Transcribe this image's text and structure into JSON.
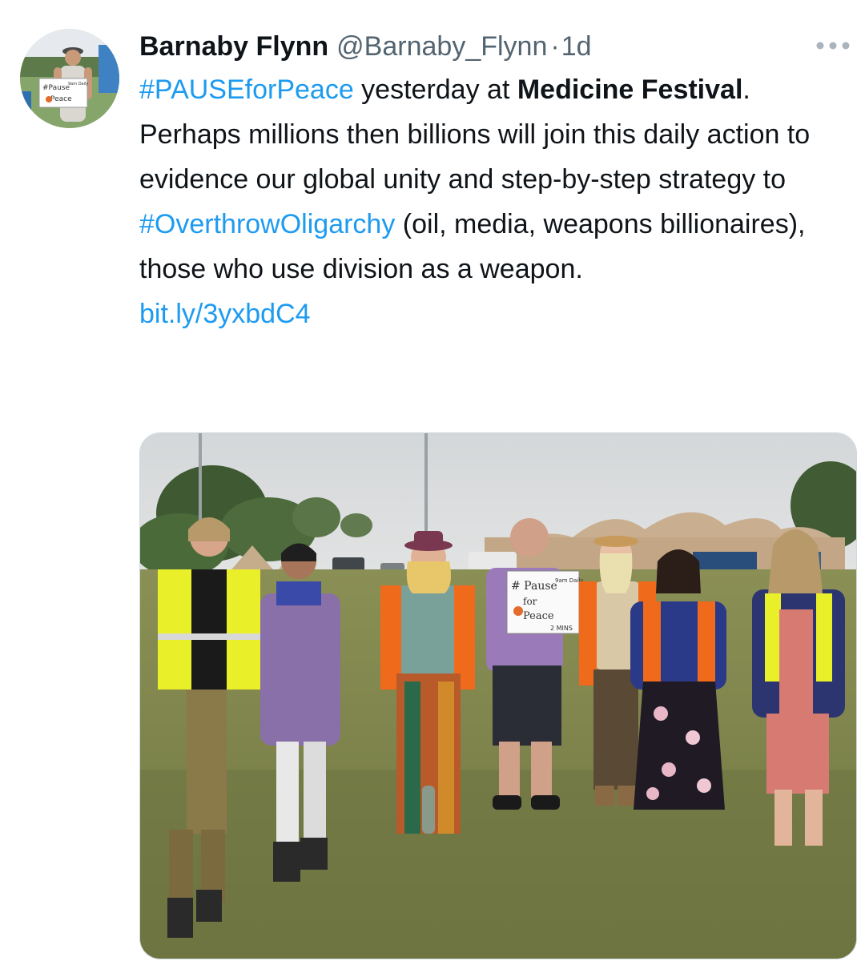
{
  "tweet": {
    "author": {
      "display_name": "Barnaby Flynn",
      "handle": "@Barnaby_Flynn",
      "separator": "·",
      "time": "1d"
    },
    "more_icon": "more-horizontal-icon",
    "text": {
      "hashtag_1": "#PAUSEforPeace",
      "part_1": " yesterday at ",
      "bold_1": "Medicine Festival",
      "part_2": ".",
      "para_2_a": "Perhaps millions then billions will join this daily action to evidence our global unity and step-by-step strategy to ",
      "hashtag_2": "#OverthrowOligarchy",
      "para_2_b": " (oil, media, weapons billionaires), those who use division as a weapon.",
      "link": "bit.ly/3yxbdC4"
    },
    "media": {
      "sign_line_1": "# Pause",
      "sign_line_2": "for",
      "sign_line_3": "Peace",
      "sign_corner": "9am Daily",
      "sign_footer": "2 MINS",
      "avatar_sign_line_1": "#Pause",
      "avatar_sign_line_2": "Peace",
      "avatar_sign_corner": "9am Daily"
    },
    "colors": {
      "link": "#1d9bf0",
      "text": "#0f1419",
      "secondary": "#536471"
    }
  }
}
